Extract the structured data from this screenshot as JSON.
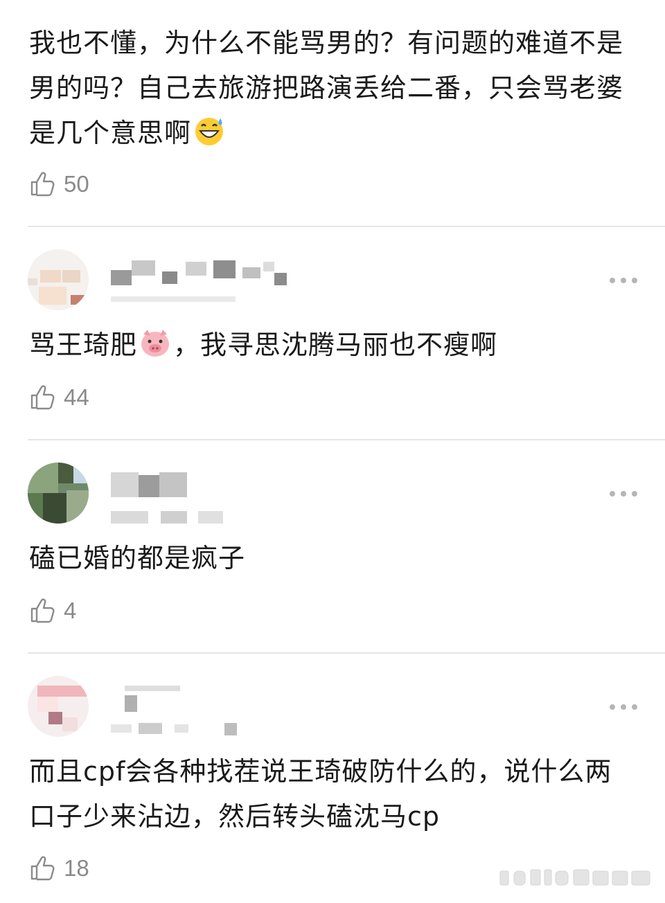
{
  "comments": [
    {
      "text": "我也不懂，为什么不能骂男的？有问题的难道不是男的吗？自己去旅游把路演丢给二番，只会骂老婆是几个意思啊",
      "emoji": "grinning-sweat-emoji",
      "likes": "50"
    },
    {
      "text_before": "骂王琦肥",
      "emoji": "pig-face-emoji",
      "text_after": "，我寻思沈腾马丽也不瘦啊",
      "likes": "44"
    },
    {
      "text": "磕已婚的都是疯子",
      "likes": "4"
    },
    {
      "text": "而且cpf会各种找茬说王琦破防什么的，说什么两口子少来沾边，然后转头磕沈马cp",
      "likes": "18"
    }
  ],
  "icons": {
    "like": "thumbs-up-icon",
    "more": "more-options-icon"
  },
  "colors": {
    "text": "#1a1a1a",
    "count": "#8a8a8a",
    "divider": "#e6e6e6",
    "dots": "#b5b5b5"
  }
}
